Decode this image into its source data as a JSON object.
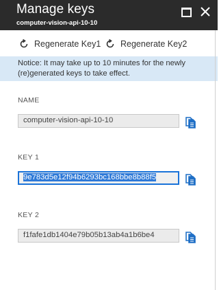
{
  "header": {
    "title": "Manage keys",
    "subtitle": "computer-vision-api-10-10"
  },
  "toolbar": {
    "regenerate_key1": "Regenerate Key1",
    "regenerate_key2": "Regenerate Key2"
  },
  "notice": {
    "line1": "Notice: It may take up to 10 minutes for the newly",
    "line2": "(re)generated keys to take effect."
  },
  "fields": {
    "name": {
      "label": "NAME",
      "value": "computer-vision-api-10-10"
    },
    "key1": {
      "label": "KEY 1",
      "value": "9e783d5e12f94b6293bc168bbe8b88f5",
      "selected": true
    },
    "key2": {
      "label": "KEY 2",
      "value": "f1fafe1db1404e79b05b13ab4a1b6be4"
    }
  },
  "icons": {
    "regenerate": "refresh-icon",
    "copy": "copy-icon",
    "maximize": "maximize-icon",
    "close": "close-icon"
  },
  "colors": {
    "header_bg": "#2b2b2b",
    "notice_bg": "#d8e8f6",
    "accent": "#1a73d9",
    "selection": "#2f7ad8"
  }
}
